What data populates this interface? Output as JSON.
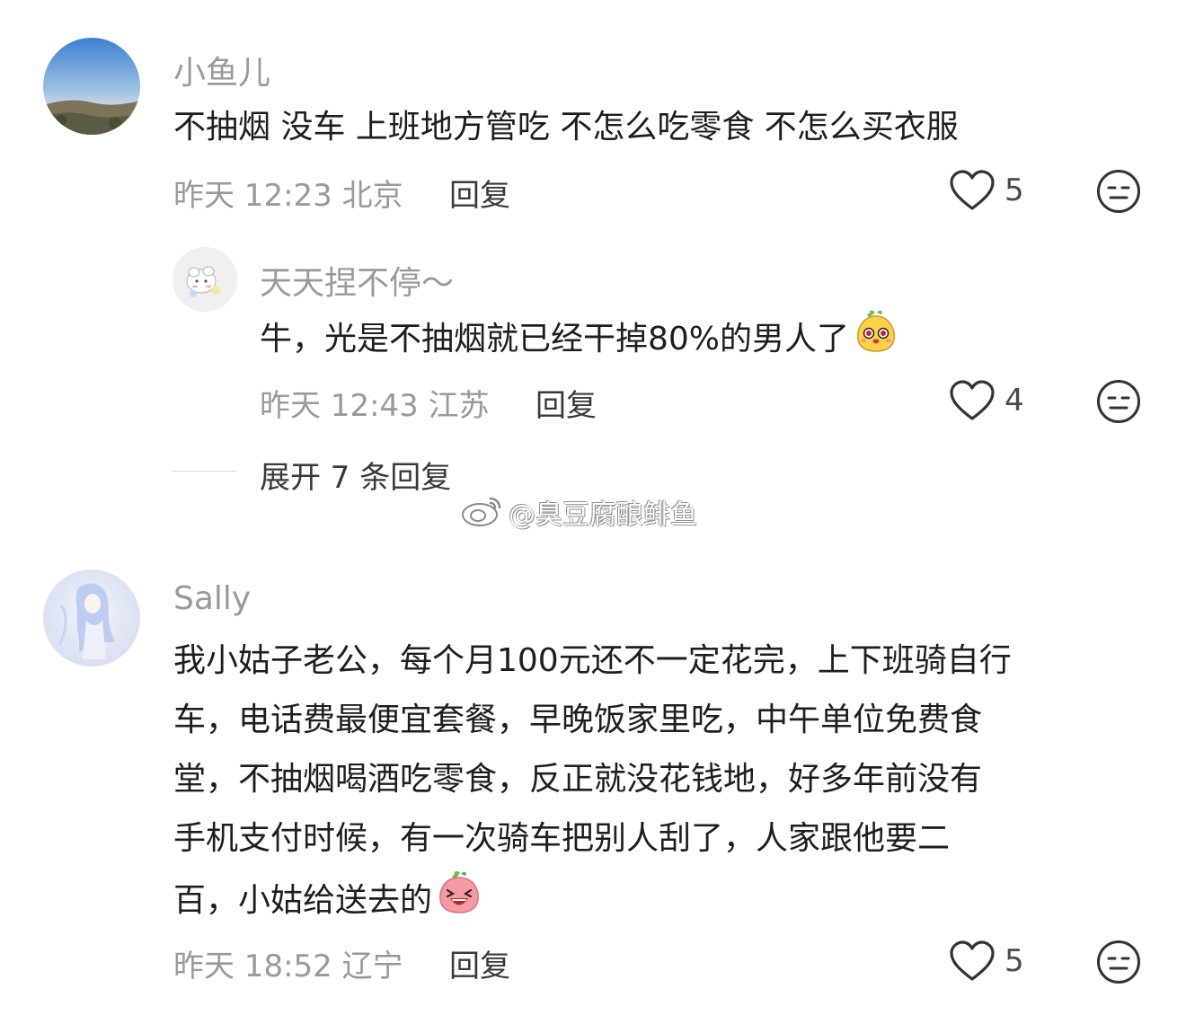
{
  "comments": [
    {
      "username": "小鱼儿",
      "text": "不抽烟 没车 上班地方管吃 不怎么吃零食 不怎么买衣服",
      "time": "昨天 12:23 北京",
      "reply_label": "回复",
      "likes": "5"
    },
    {
      "username": "天天捏不停～",
      "text": "牛，光是不抽烟就已经干掉80%的男人了",
      "time": "昨天 12:43 江苏",
      "reply_label": "回复",
      "likes": "4"
    },
    {
      "username": "Sally",
      "lines": [
        "我小姑子老公，每个月100元还不一定花完，上下班骑自行",
        "车，电话费最便宜套餐，早晚饭家里吃，中午单位免费食",
        "堂，不抽烟喝酒吃零食，反正就没花钱地，好多年前没有",
        "手机支付时候，有一次骑车把别人刮了，人家跟他要二",
        "百，小姑给送去的"
      ],
      "time": "昨天 18:52 辽宁",
      "reply_label": "回复",
      "likes": "5"
    }
  ],
  "expand_replies": "展开 7 条回复",
  "watermark": "@臭豆腐酿鲱鱼",
  "icons": {
    "like": "heart-outline-icon",
    "react": "neutral-face-icon",
    "emoji_1": "cute-mango-emoji",
    "emoji_2": "laughing-peach-emoji",
    "watermark": "weibo-logo-icon"
  }
}
